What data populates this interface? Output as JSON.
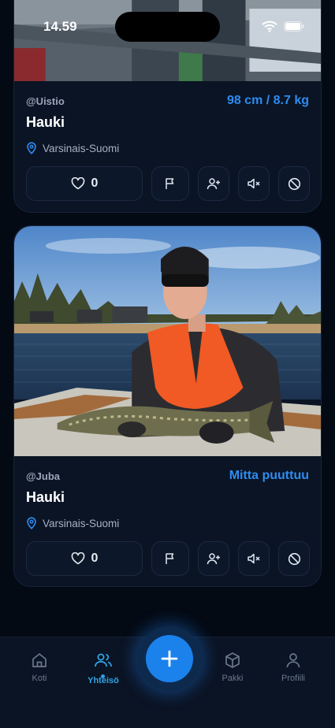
{
  "status_bar": {
    "time": "14.59"
  },
  "posts": [
    {
      "user": "@Uistio",
      "measurement": "98 cm / 8.7 kg",
      "species": "Hauki",
      "location": "Varsinais-Suomi",
      "likes": "0"
    },
    {
      "user": "@Juba",
      "measurement": "Mitta puuttuu",
      "species": "Hauki",
      "location": "Varsinais-Suomi",
      "likes": "0"
    }
  ],
  "nav": {
    "home": "Koti",
    "community": "Yhteisö",
    "pack": "Pakki",
    "profile": "Profiili"
  },
  "colors": {
    "accent": "#2d8cf0",
    "active_nav": "#2ea3e6",
    "fab": "#1b82ec",
    "card_bg": "#0a1424",
    "page_bg": "#040a14"
  },
  "icons": {
    "location": "map-pin-icon",
    "like": "heart-icon",
    "report": "flag-icon",
    "follow": "user-plus-icon",
    "mute": "volume-mute-icon",
    "block": "block-icon",
    "home": "home-icon",
    "community": "users-icon",
    "add": "plus-icon",
    "pack": "box-icon",
    "profile": "user-icon"
  }
}
